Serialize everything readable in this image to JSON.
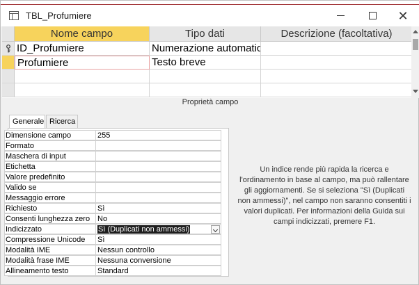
{
  "window": {
    "title": "TBL_Profumiere"
  },
  "grid": {
    "headers": [
      "Nome campo",
      "Tipo dati",
      "Descrizione (facoltativa)"
    ],
    "rows": [
      {
        "name": "ID_Profumiere",
        "type": "Numerazione automatica",
        "description": "",
        "primary_key": true
      },
      {
        "name": "Profumiere",
        "type": "Testo breve",
        "description": "",
        "current": true
      },
      {
        "name": "",
        "type": "",
        "description": ""
      }
    ]
  },
  "properties": {
    "section_label": "Proprietà campo",
    "tabs": [
      "Generale",
      "Ricerca"
    ],
    "active_tab": "Generale",
    "rows": [
      {
        "name": "Dimensione campo",
        "value": "255"
      },
      {
        "name": "Formato",
        "value": ""
      },
      {
        "name": "Maschera di input",
        "value": ""
      },
      {
        "name": "Etichetta",
        "value": ""
      },
      {
        "name": "Valore predefinito",
        "value": ""
      },
      {
        "name": "Valido se",
        "value": ""
      },
      {
        "name": "Messaggio errore",
        "value": ""
      },
      {
        "name": "Richiesto",
        "value": "Sì"
      },
      {
        "name": "Consenti lunghezza zero",
        "value": "No"
      },
      {
        "name": "Indicizzato",
        "value": "Sì (Duplicati non ammessi)"
      },
      {
        "name": "Compressione Unicode",
        "value": "Sì"
      },
      {
        "name": "Modalità IME",
        "value": "Nessun controllo"
      },
      {
        "name": "Modalità frase IME",
        "value": "Nessuna conversione"
      },
      {
        "name": "Allineamento testo",
        "value": "Standard"
      }
    ],
    "help_text": "Un indice rende più rapida la ricerca e l'ordinamento in base al campo, ma può rallentare gli aggiornamenti. Se si seleziona \"Sì (Duplicati non ammessi)\", nel campo non saranno consentiti i valori duplicati. Per informazioni della Guida sui campi indicizzati, premere F1."
  },
  "colors": {
    "active_header": "#f7d35c",
    "accent_line": "#a4373a",
    "selection": "#1e1e1e"
  }
}
